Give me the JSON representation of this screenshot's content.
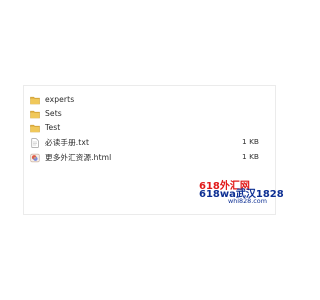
{
  "files": [
    {
      "name": "experts",
      "size": "",
      "icon": "folder-icon"
    },
    {
      "name": "Sets",
      "size": "",
      "icon": "folder-icon"
    },
    {
      "name": "Test",
      "size": "",
      "icon": "folder-icon"
    },
    {
      "name": "必读手册.txt",
      "size": "1 KB",
      "icon": "text-file-icon"
    },
    {
      "name": "更多外汇资源.html",
      "size": "1 KB",
      "icon": "html-file-icon"
    }
  ],
  "watermark": {
    "line1": "618外汇网",
    "line2": "618wa武汉1828",
    "line3": "whi828.com"
  },
  "colors": {
    "folder": "#e6b84a",
    "folder_dark": "#c99a2f",
    "watermark_red": "#e11919",
    "watermark_blue": "#0d2f93"
  }
}
